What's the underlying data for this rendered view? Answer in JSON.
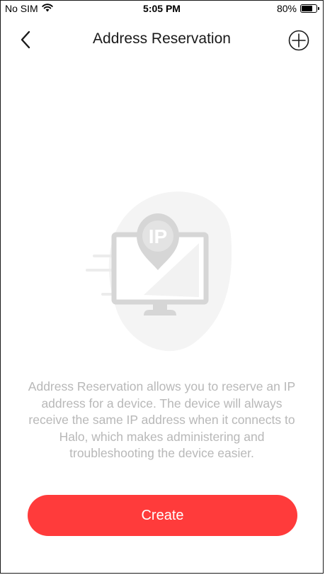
{
  "status_bar": {
    "carrier": "No SIM",
    "time": "5:05 PM",
    "battery_percent": "80%",
    "battery_level": 0.8,
    "wifi_icon": "wifi-icon"
  },
  "nav": {
    "title": "Address Reservation",
    "back_icon": "chevron-left-icon",
    "add_icon": "plus-circle-icon"
  },
  "illustration": {
    "label": "IP",
    "icon": "ip-monitor-illustration"
  },
  "description": "Address Reservation allows you to reserve an IP address for a device. The device will always receive the same IP address when it connects to Halo, which makes administering and troubleshooting the device easier.",
  "create_button": {
    "label": "Create"
  },
  "colors": {
    "accent": "#ff3b3b",
    "description_text": "#b8b8b8",
    "illustration_gray": "#d6d6d6"
  }
}
